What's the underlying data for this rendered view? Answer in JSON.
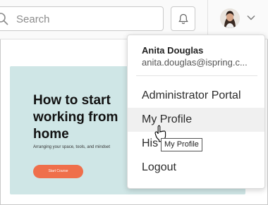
{
  "header": {
    "search": {
      "placeholder": "Search",
      "icon": "search-icon"
    },
    "notifications_icon": "bell-icon",
    "profile_menu_icon": "chevron-down-icon"
  },
  "course_card": {
    "title": "How to start working from home",
    "subtitle": "Arranging your space, tools, and mindset",
    "button_label": "Start Course",
    "background_color": "#cfe6e6",
    "button_color": "#ef6f4b"
  },
  "profile_menu": {
    "user_name": "Anita Douglas",
    "user_email": "anita.douglas@ispring.c...",
    "items": [
      {
        "label": "Administrator Portal"
      },
      {
        "label": "My Profile"
      },
      {
        "label": "His"
      },
      {
        "label": "Logout"
      }
    ],
    "hovered_item": "My Profile",
    "tooltip": "My Profile"
  }
}
